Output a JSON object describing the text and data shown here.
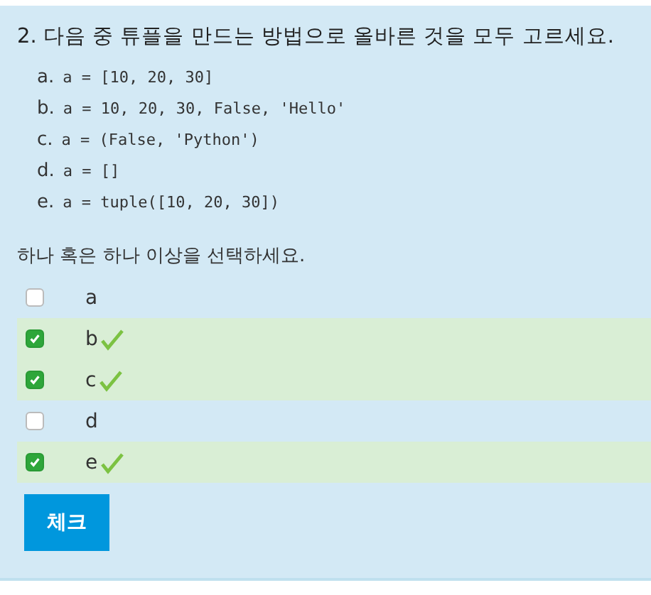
{
  "question": {
    "title": "2. 다음 중 튜플을 만드는 방법으로 올바른 것을 모두 고르세요.",
    "choices": [
      {
        "letter": "a.",
        "code": "a = [10, 20, 30]"
      },
      {
        "letter": "b.",
        "code": "a = 10, 20, 30, False, 'Hello'"
      },
      {
        "letter": "c.",
        "code": "a = (False, 'Python')"
      },
      {
        "letter": "d.",
        "code": "a = []"
      },
      {
        "letter": "e.",
        "code": "a = tuple([10, 20, 30])"
      }
    ]
  },
  "prompt": "하나 혹은 하나 이상을 선택하세요.",
  "options": [
    {
      "label": "a",
      "checked": false,
      "correct": false
    },
    {
      "label": "b",
      "checked": true,
      "correct": true
    },
    {
      "label": "c",
      "checked": true,
      "correct": true
    },
    {
      "label": "d",
      "checked": false,
      "correct": false
    },
    {
      "label": "e",
      "checked": true,
      "correct": true
    }
  ],
  "button": "체크"
}
